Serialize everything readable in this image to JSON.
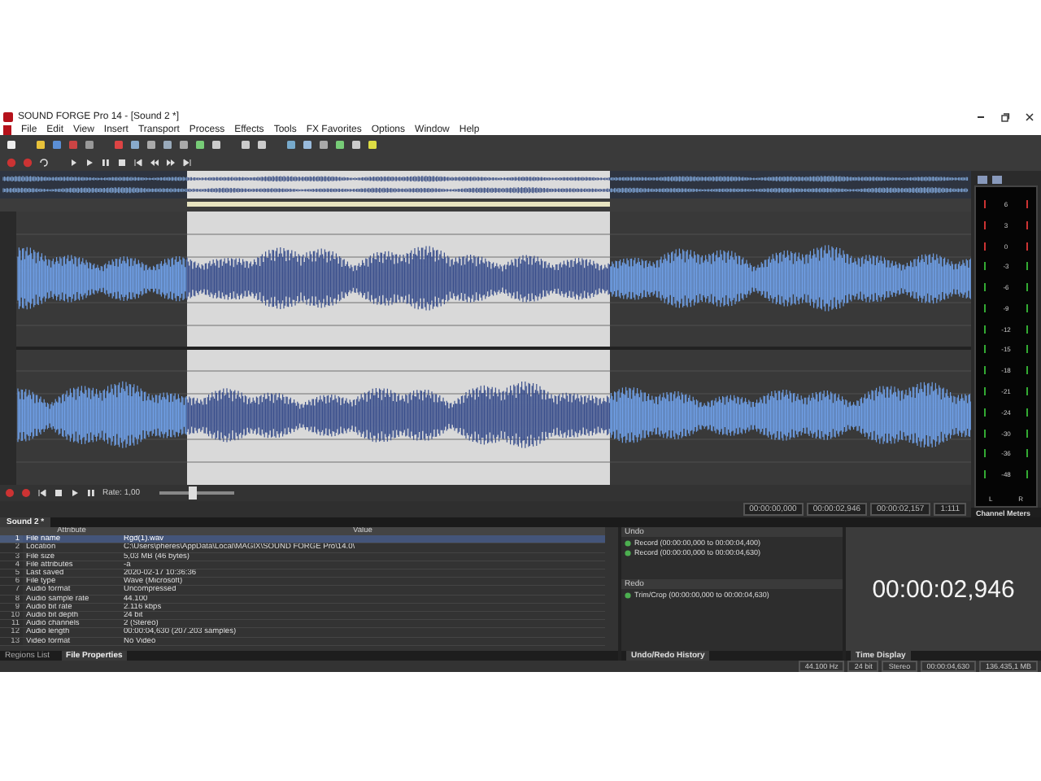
{
  "window": {
    "title": "SOUND FORGE Pro 14 - [Sound 2 *]"
  },
  "menu": [
    "File",
    "Edit",
    "View",
    "Insert",
    "Transport",
    "Process",
    "Effects",
    "Tools",
    "FX Favorites",
    "Options",
    "Window",
    "Help"
  ],
  "transport": {
    "rate_label": "Rate: 1,00",
    "rate_slider": {
      "level": 0.45
    }
  },
  "time_fields": [
    "00:00:00,000",
    "00:00:02,946",
    "00:00:02,157",
    "1:111"
  ],
  "document_tab": "Sound 2 *",
  "properties": {
    "columns": [
      "Attribute",
      "Value"
    ],
    "rows": [
      {
        "index": "1",
        "attribute": "File name",
        "value": "Rgd(1).wav",
        "selected": true
      },
      {
        "index": "2",
        "attribute": "Location",
        "value": "C:\\Users\\pheres\\AppData\\Local\\MAGIX\\SOUND FORGE Pro\\14.0\\",
        "selected": false
      },
      {
        "index": "3",
        "attribute": "File size",
        "value": "5,03 MB (46 bytes)",
        "selected": false
      },
      {
        "index": "4",
        "attribute": "File attributes",
        "value": "-a",
        "selected": false
      },
      {
        "index": "5",
        "attribute": "Last saved",
        "value": "2020-02-17  10:36:36",
        "selected": false
      },
      {
        "index": "6",
        "attribute": "File type",
        "value": "Wave (Microsoft)",
        "selected": false
      },
      {
        "index": "7",
        "attribute": "Audio format",
        "value": "Uncompressed",
        "selected": false
      },
      {
        "index": "8",
        "attribute": "Audio sample rate",
        "value": "44.100",
        "selected": false
      },
      {
        "index": "9",
        "attribute": "Audio bit rate",
        "value": "2.116 kbps",
        "selected": false
      },
      {
        "index": "10",
        "attribute": "Audio bit depth",
        "value": "24 bit",
        "selected": false
      },
      {
        "index": "11",
        "attribute": "Audio channels",
        "value": "2 (Stereo)",
        "selected": false
      },
      {
        "index": "12",
        "attribute": "Audio length",
        "value": "00:00:04,630 (207.203 samples)",
        "selected": false
      },
      {
        "index": "13",
        "attribute": "Video format",
        "value": "No Video",
        "selected": false
      }
    ]
  },
  "history": {
    "undo_label": "Undo",
    "undo_items": [
      "Record (00:00:00,000 to 00:00:04,400)",
      "Record (00:00:00,000 to 00:00:04,630)"
    ],
    "redo_label": "Redo",
    "redo_items": [
      "Trim/Crop (00:00:00,000 to 00:00:04,630)"
    ]
  },
  "time_display": "00:00:02,946",
  "meter": {
    "scale": [
      "6",
      "3",
      "0",
      "-3",
      "-6",
      "-9",
      "-12",
      "-15",
      "-18",
      "-21",
      "-24",
      "-30",
      "-36",
      "-48"
    ],
    "channels": [
      "L",
      "R"
    ],
    "tab": "Channel Meters"
  },
  "panel_tabs": {
    "properties": [
      {
        "label": "Regions List",
        "selected": false
      },
      {
        "label": "File Properties",
        "selected": true
      }
    ],
    "history": "Undo/Redo History",
    "time": "Time Display"
  },
  "status_bar": [
    "44.100 Hz",
    "24 bit",
    "Stereo",
    "00:00:04,630",
    "136.435,1 MB"
  ]
}
